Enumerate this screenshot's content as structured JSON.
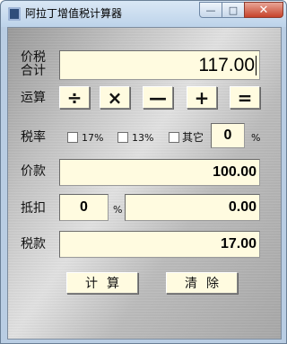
{
  "window": {
    "title": "阿拉丁增值税计算器",
    "controls": {
      "minimize": "—",
      "maximize": "□",
      "close": "✕"
    }
  },
  "labels": {
    "price_tax_total_line1": "价税",
    "price_tax_total_line2": "合计",
    "operation": "运算",
    "tax_rate": "税率",
    "price": "价款",
    "deduction": "抵扣",
    "tax": "税款",
    "percent_custom": "%",
    "percent_deduction": "%"
  },
  "fields": {
    "price_tax_total": "117.00",
    "custom_rate": "0",
    "price": "100.00",
    "deduction_percent": "0",
    "deduction_amount": "0.00",
    "tax": "17.00"
  },
  "operators": [
    "÷",
    "×",
    "—",
    "+",
    "="
  ],
  "rate_options": [
    {
      "label": "17%",
      "checked": false
    },
    {
      "label": "13%",
      "checked": false
    },
    {
      "label": "其它",
      "checked": false
    }
  ],
  "buttons": {
    "calculate": "计算",
    "clear": "清除"
  }
}
